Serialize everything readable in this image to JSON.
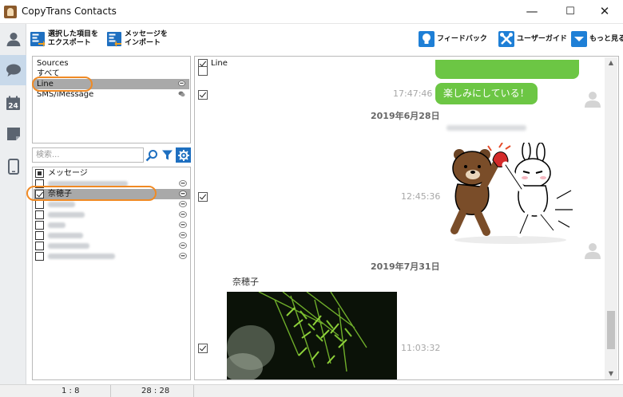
{
  "window": {
    "title": "CopyTrans Contacts",
    "min_glyph": "—",
    "max_glyph": "☐",
    "close_glyph": "✕"
  },
  "rail": {
    "items": [
      {
        "name": "contacts",
        "icon": "person-icon"
      },
      {
        "name": "messages",
        "icon": "chat-bubble-icon",
        "active": true
      },
      {
        "name": "calendar",
        "icon": "calendar-icon",
        "label": "24"
      },
      {
        "name": "notes",
        "icon": "note-icon"
      },
      {
        "name": "device",
        "icon": "phone-icon"
      }
    ]
  },
  "toolbar": {
    "export_label": "選択した項目を\nエクスポート",
    "import_label": "メッセージを\nインポート",
    "feedback_label": "フィードバック",
    "guide_label": "ユーザーガイド",
    "more_label": "もっと見る"
  },
  "sources": {
    "header": "Sources",
    "items": [
      {
        "label": "すべて",
        "selected": false
      },
      {
        "label": "Line",
        "selected": true
      },
      {
        "label": "SMS/iMessage",
        "selected": false
      }
    ]
  },
  "search": {
    "placeholder": "検索..."
  },
  "contacts": {
    "header": "メッセージ",
    "selected_contact": "奈穂子"
  },
  "conversation": {
    "source_label": "Line",
    "messages": [
      {
        "time": "17:47:46",
        "text": "楽しみにしている！"
      },
      {
        "date": "2019年6月28日"
      },
      {
        "time": "12:45:36",
        "type": "sticker"
      },
      {
        "date": "2019年7月31日"
      },
      {
        "sender": "奈穂子",
        "time": "11:03:32",
        "type": "photo"
      }
    ]
  },
  "status": {
    "left": "1 : 8",
    "right": "28 : 28"
  },
  "colors": {
    "bubble_green": "#6cc644",
    "highlight_orange": "#f08a24",
    "accent_blue": "#1e7fd6"
  }
}
